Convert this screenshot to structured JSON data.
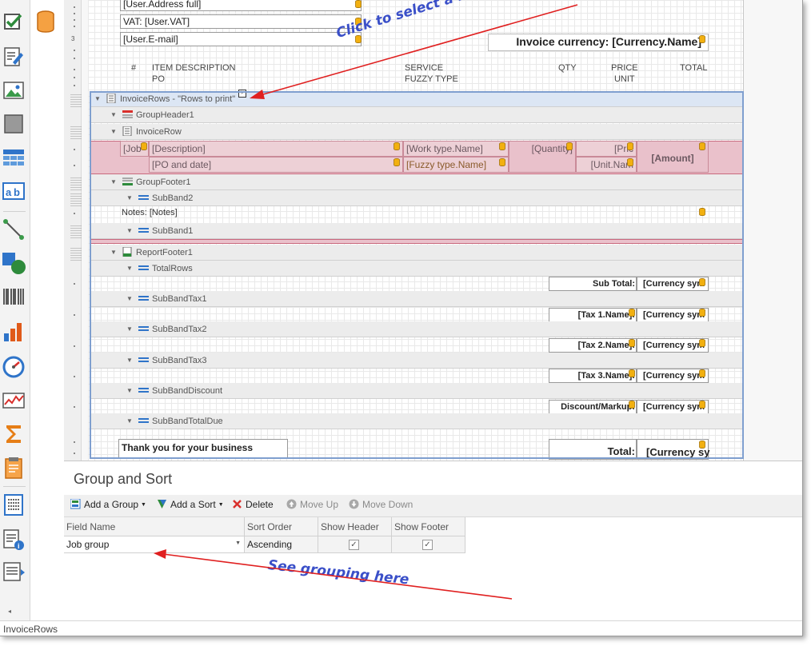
{
  "colors": {
    "accent": "#3a4fc8",
    "selection_pink": "#eac1cb",
    "selection_border": "#7f9fcf",
    "arrow": "#e02020"
  },
  "toolbox": {
    "icons": [
      "checkbox-icon",
      "richtext-icon",
      "picture-icon",
      "panel-icon",
      "table-icon",
      "label-icon",
      "line-icon",
      "shape-icon",
      "barcode-icon",
      "chart-icon",
      "gauge-icon",
      "sparkline-icon",
      "summary-icon",
      "pageinfo-icon",
      "toc-icon",
      "subreport-icon",
      "crossband-icon"
    ]
  },
  "ruler": {
    "number": "3"
  },
  "report": {
    "user_address": "[User.Address full]",
    "user_vat": "VAT: [User.VAT]",
    "user_email": "[User.E-mail]",
    "invoice_currency": "Invoice currency: [Currency.Name]",
    "headers": {
      "num": "#",
      "item_line1": "ITEM DESCRIPTION",
      "item_line2": "PO",
      "service_line1": "SERVICE",
      "service_line2": "FUZZY TYPE",
      "qty": "QTY",
      "price_line1": "PRICE",
      "price_line2": "UNIT",
      "total": "TOTAL"
    },
    "bands": {
      "invoice_rows": "InvoiceRows - \"Rows to print\"",
      "group_header": "GroupHeader1",
      "invoice_row": "InvoiceRow",
      "group_footer": "GroupFooter1",
      "subband2": "SubBand2",
      "subband1": "SubBand1",
      "report_footer": "ReportFooter1",
      "total_rows": "TotalRows",
      "subband_tax1": "SubBandTax1",
      "subband_tax2": "SubBandTax2",
      "subband_tax3": "SubBandTax3",
      "subband_discount": "SubBandDiscount",
      "subband_total_due": "SubBandTotalDue"
    },
    "row_fields": {
      "job": "[Job",
      "description": "[Description]",
      "work_type": "[Work type.Name]",
      "quantity": "[Quantity]",
      "price": "[Pric",
      "amount": "[Amount]",
      "po_and_date": "[PO and date]",
      "fuzzy_type": "[Fuzzy type.Name]",
      "unit_name": "[Unit.Nam"
    },
    "notes": "Notes: [Notes]",
    "totals": {
      "subtotal_label": "Sub Total:",
      "currency_sym": "[Currency sym",
      "tax1_label": "[Tax 1.Name]:",
      "tax2_label": "[Tax 2.Name]:",
      "tax3_label": "[Tax 3.Name]:",
      "discount_label": "Discount/Markup:",
      "thank_you": "Thank you for your business",
      "total_label": "Total:",
      "currency_sym_big": "[Currency sy"
    }
  },
  "annotations": {
    "click_band": "Click to select a band",
    "see_grouping": "See grouping here"
  },
  "group_sort": {
    "title": "Group and Sort",
    "toolbar": {
      "add_group": "Add a Group",
      "add_sort": "Add a Sort",
      "delete": "Delete",
      "move_up": "Move Up",
      "move_down": "Move Down"
    },
    "columns": [
      "Field Name",
      "Sort Order",
      "Show Header",
      "Show Footer"
    ],
    "row": {
      "field_name": "Job group",
      "sort_order": "Ascending",
      "show_header": true,
      "show_footer": true
    }
  },
  "status_bar": {
    "text": "InvoiceRows"
  }
}
